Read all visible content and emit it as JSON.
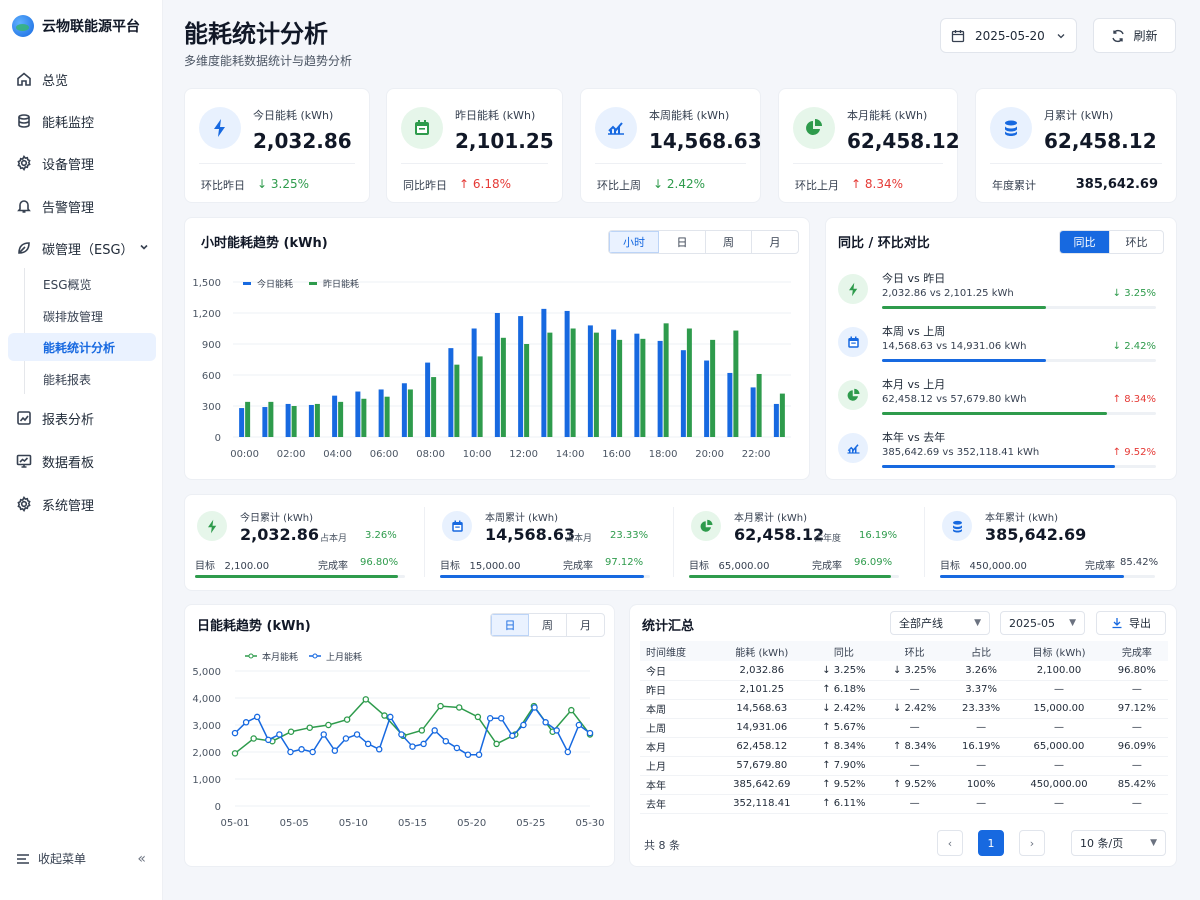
{
  "app": {
    "name": "云物联能源平台"
  },
  "sidebar": {
    "items": [
      {
        "label": "总览",
        "icon": "home-icon"
      },
      {
        "label": "能耗监控",
        "icon": "database-icon"
      },
      {
        "label": "设备管理",
        "icon": "gear-icon"
      },
      {
        "label": "告警管理",
        "icon": "bell-icon"
      },
      {
        "label": "碳管理（ESG）",
        "icon": "leaf-icon"
      },
      {
        "label": "报表分析",
        "icon": "chart-icon"
      },
      {
        "label": "数据看板",
        "icon": "monitor-icon"
      },
      {
        "label": "系统管理",
        "icon": "settings-icon"
      }
    ],
    "sub_items": [
      "ESG概览",
      "碳排放管理",
      "能耗统计分析",
      "能耗报表"
    ],
    "active_sub": "能耗统计分析",
    "collapse_label": "收起菜单"
  },
  "header": {
    "title": "能耗统计分析",
    "subtitle": "多维度能耗数据统计与趋势分析",
    "date": "2025-05-20",
    "refresh_label": "刷新"
  },
  "kpis": [
    {
      "label": "今日能耗 (kWh)",
      "value": "2,032.86",
      "foot": "环比昨日",
      "pct": "↓ 3.25%",
      "dir": "down",
      "icon": "bolt-icon",
      "color": "#1769e0",
      "bg": "#e8f1fe"
    },
    {
      "label": "昨日能耗 (kWh)",
      "value": "2,101.25",
      "foot": "同比昨日",
      "pct": "↑ 6.18%",
      "dir": "up",
      "icon": "calendar-icon",
      "color": "#2e9b4c",
      "bg": "#e6f6ea"
    },
    {
      "label": "本周能耗 (kWh)",
      "value": "14,568.63",
      "foot": "环比上周",
      "pct": "↓ 2.42%",
      "dir": "down",
      "icon": "trend-icon",
      "color": "#1769e0",
      "bg": "#e8f1fe"
    },
    {
      "label": "本月能耗 (kWh)",
      "value": "62,458.12",
      "foot": "环比上月",
      "pct": "↑ 8.34%",
      "dir": "up",
      "icon": "pie-icon",
      "color": "#2e9b4c",
      "bg": "#e6f6ea"
    },
    {
      "label": "月累计 (kWh)",
      "value": "62,458.12",
      "foot": "年度累计",
      "pct": "385,642.69",
      "dir": "none",
      "icon": "stack-icon",
      "color": "#1769e0",
      "bg": "#e8f1fe"
    }
  ],
  "hourly_panel": {
    "title": "小时能耗趋势 (kWh)",
    "tabs": [
      "小时",
      "日",
      "周",
      "月"
    ],
    "active": "小时"
  },
  "compare_panel": {
    "title": "同比 / 环比对比",
    "tabs": [
      "同比",
      "环比"
    ],
    "active": "同比",
    "rows": [
      {
        "title": "今日 vs 昨日",
        "values": "2,032.86  vs  2,101.25  kWh",
        "pct": "↓ 3.25%",
        "dir": "down",
        "fill": 0.6,
        "color": "#2e9b4c",
        "icon": "bolt-icon",
        "bg": "#e6f6ea"
      },
      {
        "title": "本周 vs 上周",
        "values": "14,568.63  vs  14,931.06  kWh",
        "pct": "↓ 2.42%",
        "dir": "down",
        "fill": 0.6,
        "color": "#1769e0",
        "icon": "calendar-icon",
        "bg": "#e8f1fe"
      },
      {
        "title": "本月 vs 上月",
        "values": "62,458.12  vs  57,679.80  kWh",
        "pct": "↑ 8.34%",
        "dir": "up",
        "fill": 0.82,
        "color": "#2e9b4c",
        "icon": "pie-icon",
        "bg": "#e6f6ea"
      },
      {
        "title": "本年 vs 去年",
        "values": "385,642.69  vs  352,118.41  kWh",
        "pct": "↑ 9.52%",
        "dir": "up",
        "fill": 0.85,
        "color": "#1769e0",
        "icon": "trend-icon",
        "bg": "#e8f1fe"
      }
    ]
  },
  "cumulative": [
    {
      "label": "今日累计 (kWh)",
      "value": "2,032.86",
      "share_label": "占本月",
      "share": "3.26%",
      "target_label": "目标",
      "target": "2,100.00",
      "rate_label": "完成率",
      "rate": "96.80%",
      "fill": 0.968,
      "color": "#2e9b4c",
      "icon": "bolt-icon",
      "bg": "#e6f6ea"
    },
    {
      "label": "本周累计 (kWh)",
      "value": "14,568.63",
      "share_label": "占本月",
      "share": "23.33%",
      "target_label": "目标",
      "target": "15,000.00",
      "rate_label": "完成率",
      "rate": "97.12%",
      "fill": 0.971,
      "color": "#1769e0",
      "icon": "calendar-icon",
      "bg": "#e8f1fe"
    },
    {
      "label": "本月累计 (kWh)",
      "value": "62,458.12",
      "share_label": "占年度",
      "share": "16.19%",
      "target_label": "目标",
      "target": "65,000.00",
      "rate_label": "完成率",
      "rate": "96.09%",
      "fill": 0.961,
      "color": "#2e9b4c",
      "icon": "pie-icon",
      "bg": "#e6f6ea"
    },
    {
      "label": "本年累计 (kWh)",
      "value": "385,642.69",
      "share_label": "",
      "share": "",
      "target_label": "目标",
      "target": "450,000.00",
      "rate_label": "完成率",
      "rate": "85.42%",
      "fill": 0.854,
      "color": "#1769e0",
      "icon": "stack-icon",
      "bg": "#e8f1fe"
    }
  ],
  "daily_panel": {
    "title": "日能耗趋势 (kWh)",
    "tabs": [
      "日",
      "周",
      "月"
    ],
    "active": "日"
  },
  "summary": {
    "title": "统计汇总",
    "filter_line": "全部产线",
    "filter_month": "2025-05",
    "export_label": "导出",
    "columns": [
      "时间维度",
      "能耗 (kWh)",
      "同比",
      "环比",
      "占比",
      "目标 (kWh)",
      "完成率"
    ],
    "rows": [
      [
        "今日",
        "2,032.86",
        "↓ 3.25%",
        "↓ 3.25%",
        "3.26%",
        "2,100.00",
        "96.80%"
      ],
      [
        "昨日",
        "2,101.25",
        "↑ 6.18%",
        "—",
        "3.37%",
        "—",
        "—"
      ],
      [
        "本周",
        "14,568.63",
        "↓ 2.42%",
        "↓ 2.42%",
        "23.33%",
        "15,000.00",
        "97.12%"
      ],
      [
        "上周",
        "14,931.06",
        "↑ 5.67%",
        "—",
        "—",
        "—",
        "—"
      ],
      [
        "本月",
        "62,458.12",
        "↑ 8.34%",
        "↑ 8.34%",
        "16.19%",
        "65,000.00",
        "96.09%"
      ],
      [
        "上月",
        "57,679.80",
        "↑ 7.90%",
        "—",
        "—",
        "—",
        "—"
      ],
      [
        "本年",
        "385,642.69",
        "↑ 9.52%",
        "↑ 9.52%",
        "100%",
        "450,000.00",
        "85.42%"
      ],
      [
        "去年",
        "352,118.41",
        "↑ 6.11%",
        "—",
        "—",
        "—",
        "—"
      ]
    ],
    "total": "共 8 条",
    "page": "1",
    "page_size": "10 条/页"
  },
  "colors": {
    "blue": "#1769e0",
    "green": "#2e9b4c",
    "red": "#e53935"
  },
  "chart_data": [
    {
      "type": "bar",
      "title": "小时能耗趋势 (kWh)",
      "categories": [
        "00:00",
        "01:00",
        "02:00",
        "03:00",
        "04:00",
        "05:00",
        "06:00",
        "07:00",
        "08:00",
        "09:00",
        "10:00",
        "11:00",
        "12:00",
        "13:00",
        "14:00",
        "15:00",
        "16:00",
        "17:00",
        "18:00",
        "19:00",
        "20:00",
        "21:00",
        "22:00",
        "23:00"
      ],
      "x_tick_labels": [
        "00:00",
        "02:00",
        "04:00",
        "06:00",
        "08:00",
        "10:00",
        "12:00",
        "14:00",
        "16:00",
        "18:00",
        "20:00",
        "22:00"
      ],
      "series": [
        {
          "name": "今日能耗",
          "color": "#1769e0",
          "values": [
            280,
            290,
            320,
            310,
            400,
            440,
            460,
            520,
            720,
            860,
            1050,
            1200,
            1170,
            1240,
            1220,
            1080,
            1040,
            1000,
            930,
            840,
            740,
            620,
            480,
            320
          ]
        },
        {
          "name": "昨日能耗",
          "color": "#2e9b4c",
          "values": [
            340,
            340,
            300,
            320,
            340,
            370,
            390,
            460,
            580,
            700,
            780,
            960,
            900,
            1010,
            1050,
            1010,
            940,
            950,
            1100,
            1050,
            940,
            1030,
            610,
            420
          ]
        }
      ],
      "ylim": [
        0,
        1500
      ],
      "yticks": [
        "0",
        "300",
        "600",
        "900",
        "1,200",
        "1,500"
      ],
      "legend": "top-left",
      "grid": true
    },
    {
      "type": "line",
      "title": "日能耗趋势 (kWh)",
      "x": [
        "05-01",
        "05-02",
        "05-03",
        "05-04",
        "05-05",
        "05-06",
        "05-07",
        "05-08",
        "05-09",
        "05-10",
        "05-11",
        "05-12",
        "05-13",
        "05-14",
        "05-15",
        "05-16",
        "05-17",
        "05-18",
        "05-19",
        "05-20",
        "05-21",
        "05-22",
        "05-23",
        "05-24",
        "05-25",
        "05-26",
        "05-27",
        "05-28",
        "05-29",
        "05-30"
      ],
      "x_tick_labels": [
        "05-01",
        "05-05",
        "05-10",
        "05-15",
        "05-20",
        "05-25",
        "05-30"
      ],
      "series": [
        {
          "name": "本月能耗",
          "color": "#2e9b4c",
          "values": [
            1950,
            2500,
            2400,
            2750,
            2900,
            3000,
            3200,
            3950,
            3350,
            2600,
            2800,
            3700,
            3650,
            3300,
            2300,
            2650,
            3700,
            2750,
            3550,
            2650
          ]
        },
        {
          "name": "上月能耗",
          "color": "#1769e0",
          "values": [
            2700,
            3100,
            3300,
            2450,
            2650,
            2000,
            2100,
            2000,
            2650,
            2050,
            2500,
            2650,
            2300,
            2100,
            3300,
            2650,
            2200,
            2300,
            2800,
            2400,
            2150,
            1900,
            1900,
            3250,
            3250,
            2600,
            3000,
            3650,
            3100,
            2800,
            2000,
            3000,
            2700
          ]
        }
      ],
      "ylim": [
        0,
        5000
      ],
      "yticks": [
        "0",
        "1,000",
        "2,000",
        "3,000",
        "4,000",
        "5,000"
      ],
      "legend": "top-left",
      "grid": true
    }
  ]
}
